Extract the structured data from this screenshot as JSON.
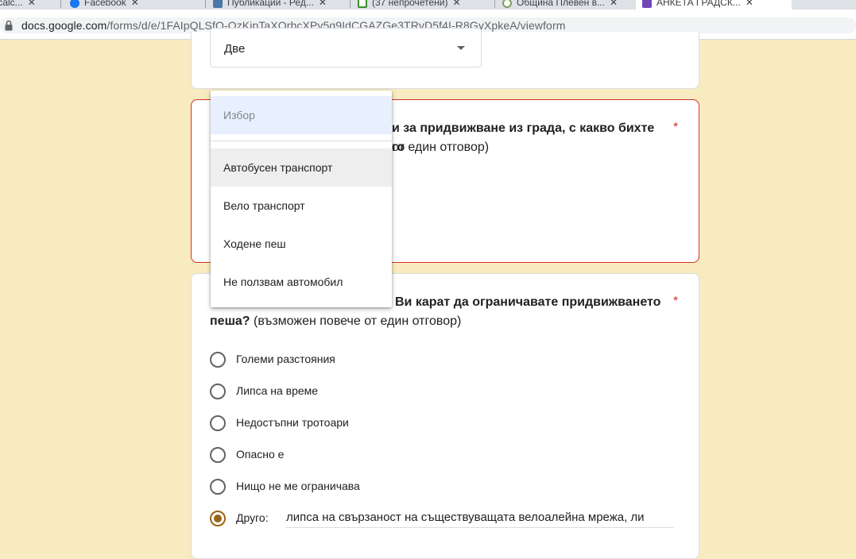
{
  "browser": {
    "tabs": [
      {
        "label": "tcalc...",
        "close": "✕"
      },
      {
        "label": "Facebook",
        "close": "✕"
      },
      {
        "label": "Публикации - Ред...",
        "close": "✕"
      },
      {
        "label": "(37 непрочетени)",
        "close": "✕"
      },
      {
        "label": "Община Плевен в...",
        "close": "✕"
      },
      {
        "label": "АНКЕТА ГРАДСК...",
        "close": "✕"
      }
    ],
    "url_host": "docs.google.com",
    "url_path": "/forms/d/e/1FAIpQLSfQ-QzKipTaXOrbcXPv5q9IdCGAZGe3TRvD5f4I-R8GyXpkeA/viewform"
  },
  "prev_question": {
    "selected_value": "Две"
  },
  "question_car": {
    "title_bold": "и за придвижване из града, с какво бихте го",
    "subtitle": "от един отговор)",
    "required_mark": "*"
  },
  "dropdown": {
    "placeholder": "Избор",
    "options": [
      "Автобусен транспорт",
      "Вело транспорт",
      "Ходене пеш",
      "Не ползвам автомобил"
    ]
  },
  "question_walk": {
    "title_bold_line1": "Ви карат да ограничавате придвижването",
    "title_bold_line2": "пеша?",
    "title_rest": " (възможен повече от един отговор)",
    "required_mark": "*",
    "options": [
      "Големи разстояния",
      "Липса на време",
      "Недостъпни тротоари",
      "Опасно е",
      "Нищо не ме ограничава"
    ],
    "other_label": "Друго:",
    "other_value": "липса на свързаност на съществуващата велоалейна мрежа, ли"
  },
  "colors": {
    "background": "#f7ebbf",
    "accent": "#996515",
    "error": "#d93025"
  }
}
